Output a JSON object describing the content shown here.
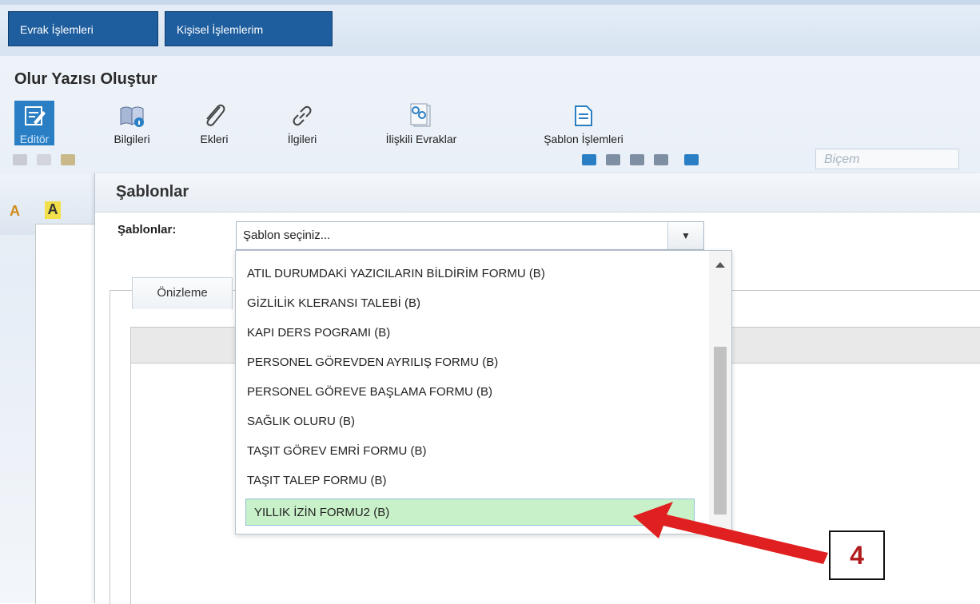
{
  "topnav": {
    "tabs": [
      "Evrak İşlemleri",
      "Kişisel İşlemlerim"
    ]
  },
  "page": {
    "title": "Olur Yazısı Oluştur"
  },
  "tools": {
    "editor": "Editör",
    "bilgileri": "Bilgileri",
    "ekleri": "Ekleri",
    "ilgileri": "İlgileri",
    "iliskili": "İlişkili Evraklar",
    "sablon": "Şablon İşlemleri"
  },
  "editor": {
    "style_select": "Biçem"
  },
  "modal": {
    "title": "Şablonlar",
    "label": "Şablonlar:",
    "select_value": "Şablon seçiniz...",
    "preview_tab": "Önizleme"
  },
  "dropdown": {
    "options": [
      "ATIL DURUMDAKİ YAZICILARIN BİLDİRİM FORMU (B)",
      "GİZLİLİK KLERANSI TALEBİ (B)",
      "KAPI DERS POGRAMI (B)",
      "PERSONEL GÖREVDEN AYRILIŞ FORMU (B)",
      "PERSONEL GÖREVE BAŞLAMA FORMU (B)",
      "SAĞLIK OLURU (B)",
      "TAŞIT GÖREV EMRİ FORMU (B)",
      "TAŞIT TALEP FORMU (B)",
      "YILLIK İZİN FORMU2 (B)"
    ],
    "selected_index": 8
  },
  "annotation": {
    "step": "4",
    "color": "#e02020"
  },
  "icons": [
    "editor-icon",
    "book-icon",
    "paperclip-icon",
    "link-icon",
    "related-docs-icon",
    "template-icon",
    "chevron-down-icon",
    "scroll-up-icon"
  ]
}
